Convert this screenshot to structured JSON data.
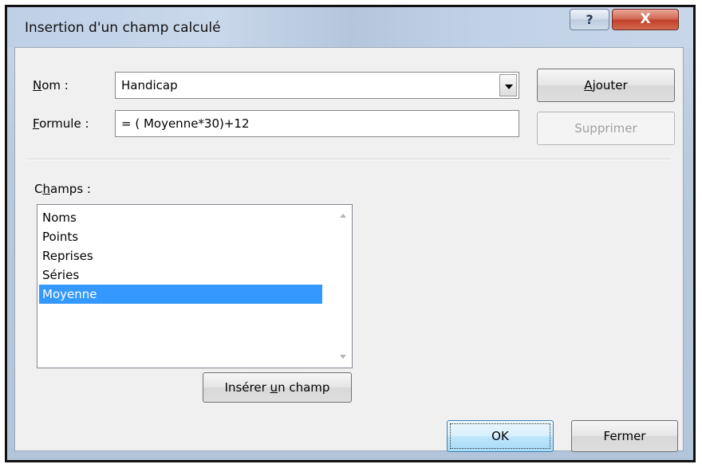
{
  "window": {
    "title": "Insertion d'un champ calculé",
    "help_label": "?",
    "close_label": "X"
  },
  "name_field": {
    "label_accel": "N",
    "label_rest": "om :",
    "value": "Handicap"
  },
  "formula_field": {
    "label_accel": "F",
    "label_rest": "ormule :",
    "value": "= ( Moyenne*30)+12"
  },
  "buttons": {
    "add_accel": "A",
    "add_rest": "jouter",
    "delete_label": "Supprimer",
    "insert_pre": "Insérer ",
    "insert_accel": "u",
    "insert_post": "n champ",
    "ok_label": "OK",
    "close_label": "Fermer"
  },
  "fields_list": {
    "label_pre": "C",
    "label_accel": "h",
    "label_post": "amps :",
    "items": [
      "Noms",
      "Points",
      "Reprises",
      "Séries",
      "Moyenne"
    ],
    "selected": "Moyenne"
  },
  "icons": {
    "help": "question-mark-icon",
    "close": "close-x-icon",
    "dropdown": "chevron-down-icon",
    "scroll_up": "scroll-up-arrow-icon",
    "scroll_down": "scroll-down-arrow-icon"
  },
  "colors": {
    "selection": "#3399ff",
    "close_button": "#c2412b",
    "title_bar": "#bfd0e6"
  }
}
